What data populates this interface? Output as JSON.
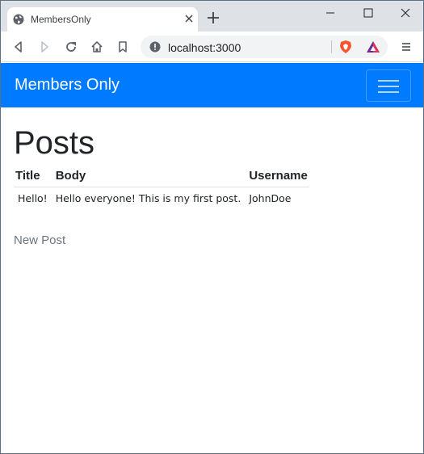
{
  "browser": {
    "tab_title": "MembersOnly",
    "url": "localhost:3000"
  },
  "navbar": {
    "brand": "Members Only"
  },
  "main": {
    "heading": "Posts",
    "table": {
      "columns": [
        "Title",
        "Body",
        "Username"
      ],
      "rows": [
        [
          "Hello!",
          "Hello everyone! This is my first post.",
          "JohnDoe"
        ]
      ]
    },
    "new_post_link": "New Post"
  },
  "colors": {
    "navbar": "#007bff",
    "tabstrip": "#dee1e6",
    "link_muted": "#6c757d"
  }
}
